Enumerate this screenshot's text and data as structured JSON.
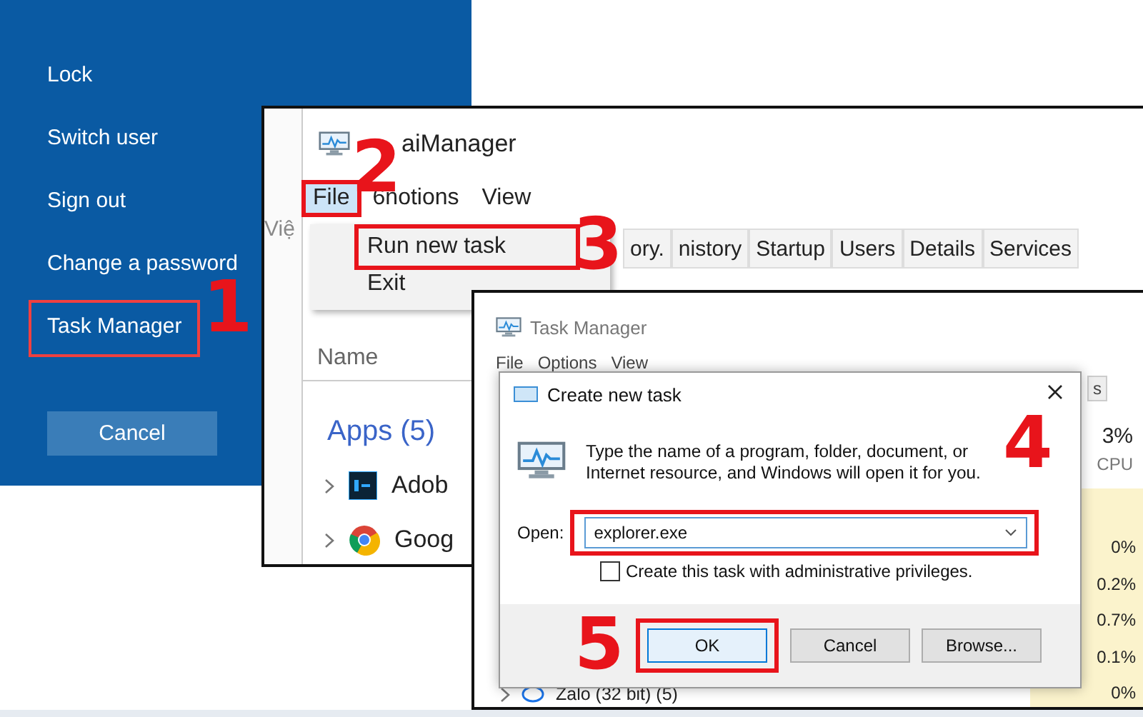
{
  "power_menu": {
    "items": [
      {
        "label": "Lock",
        "selected": false
      },
      {
        "label": "Switch user",
        "selected": false
      },
      {
        "label": "Sign out",
        "selected": false
      },
      {
        "label": "Change a password",
        "selected": false
      },
      {
        "label": "Task Manager",
        "selected": true
      }
    ],
    "cancel_button": "Cancel"
  },
  "steps": [
    "1",
    "2",
    "3",
    "4",
    "5"
  ],
  "task_manager_back": {
    "side_text": "Việ",
    "title": "aiManager",
    "menu": [
      {
        "label": "File",
        "selected": true
      },
      {
        "label": "6notions",
        "selected": false
      },
      {
        "label": "View",
        "selected": false
      }
    ],
    "dropdown": [
      {
        "label": "Run new task",
        "highlighted": true
      },
      {
        "label": "Exit",
        "highlighted": false
      }
    ],
    "tabs": [
      "ory.",
      "nistory",
      "Startup",
      "Users",
      "Details",
      "Services"
    ],
    "column": "Name",
    "group": "Apps (5)",
    "rows": [
      {
        "name": "Adob",
        "kind": "ps"
      },
      {
        "name": "Goog",
        "kind": "chrome"
      }
    ]
  },
  "task_manager_front": {
    "title": "Task Manager",
    "menu": [
      "File",
      "Options",
      "View"
    ],
    "tab_fragment": "s",
    "cpu_value": "3%",
    "cpu_label": "CPU",
    "cpu_cells": [
      "0%",
      "0.2%",
      "0.7%",
      "0.1%",
      "0%"
    ],
    "bottom_row": "Zalo (32 bit) (5)"
  },
  "dialog": {
    "title": "Create new task",
    "message": "Type the name of a program, folder, document, or Internet resource, and Windows will open it for you.",
    "open_label": "Open:",
    "value": "explorer.exe",
    "admin_checkbox": {
      "label": "Create this task with administrative privileges.",
      "checked": false
    },
    "buttons": [
      {
        "label": "OK",
        "highlighted": true
      },
      {
        "label": "Cancel",
        "highlighted": false
      },
      {
        "label": "Browse...",
        "highlighted": false
      }
    ]
  }
}
